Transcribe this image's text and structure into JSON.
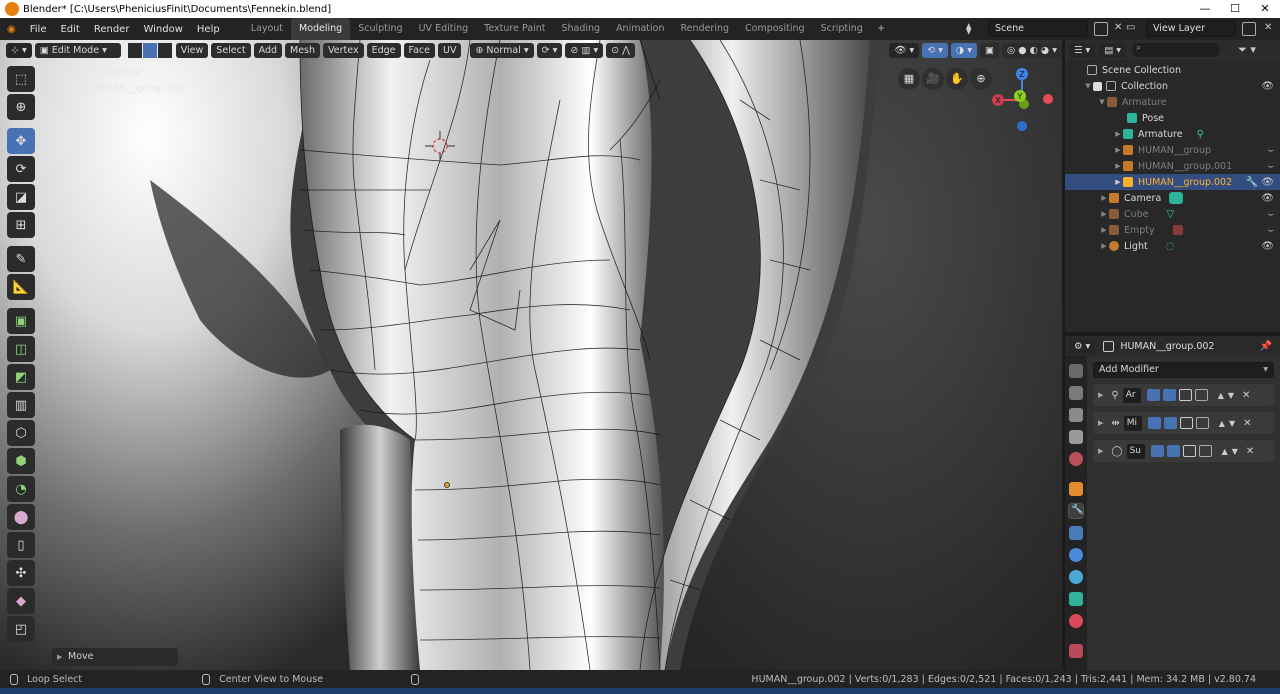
{
  "window": {
    "title": "Blender* [C:\\Users\\PheniciusFinit\\Documents\\Fennekin.blend]",
    "minimize": "—",
    "maximize": "☐",
    "close": "✕"
  },
  "menu": [
    "File",
    "Edit",
    "Render",
    "Window",
    "Help"
  ],
  "workspaces": {
    "tabs": [
      "Layout",
      "Modeling",
      "Sculpting",
      "UV Editing",
      "Texture Paint",
      "Shading",
      "Animation",
      "Rendering",
      "Compositing",
      "Scripting"
    ],
    "active": "Modeling",
    "add": "+"
  },
  "scene": {
    "name": "Scene",
    "view_layer": "View Layer"
  },
  "viewport_header": {
    "mode": "Edit Mode",
    "menus": [
      "View",
      "Select",
      "Add",
      "Mesh",
      "Vertex",
      "Edge",
      "Face",
      "UV"
    ],
    "orientation": "Normal"
  },
  "viewport": {
    "perspective": "User Perspective",
    "object_info": "(133) HUMAN__group.002",
    "last_operator": "Move"
  },
  "gizmo": {
    "z": "Z",
    "y": "Y",
    "x": "X"
  },
  "outliner": {
    "search_placeholder": "",
    "rows": [
      {
        "name": "Scene Collection",
        "state": "normal"
      },
      {
        "name": "Collection",
        "state": "normal"
      },
      {
        "name": "Armature",
        "state": "dim"
      },
      {
        "name": "Pose",
        "state": "normal"
      },
      {
        "name": "Armature",
        "state": "normal"
      },
      {
        "name": "HUMAN__group",
        "state": "dim"
      },
      {
        "name": "HUMAN__group.001",
        "state": "dim"
      },
      {
        "name": "HUMAN__group.002",
        "state": "active"
      },
      {
        "name": "Camera",
        "state": "normal"
      },
      {
        "name": "Cube",
        "state": "dim"
      },
      {
        "name": "Empty",
        "state": "dim"
      },
      {
        "name": "Light",
        "state": "normal"
      }
    ]
  },
  "properties": {
    "object_name": "HUMAN__group.002",
    "add_modifier": "Add Modifier",
    "modifiers": [
      {
        "short": "Ar",
        "icon": "armature-modifier-icon"
      },
      {
        "short": "Mi",
        "icon": "mirror-modifier-icon"
      },
      {
        "short": "Su",
        "icon": "subdivision-modifier-icon"
      }
    ]
  },
  "statusbar": {
    "left_action": "Loop Select",
    "middle_action": "Center View to Mouse",
    "stats": "HUMAN__group.002 | Verts:0/1,283 | Edges:0/2,521 | Faces:0/1,243 | Tris:2,441 | Mem: 34.2 MB | v2.80.74"
  },
  "colors": {
    "accent": "#4772b3",
    "active_object": "#ffaf29",
    "selection_row": "#334d80",
    "gizmo_x": "#e84b5a",
    "gizmo_y": "#8ccf1d",
    "gizmo_z": "#3e86e8"
  }
}
